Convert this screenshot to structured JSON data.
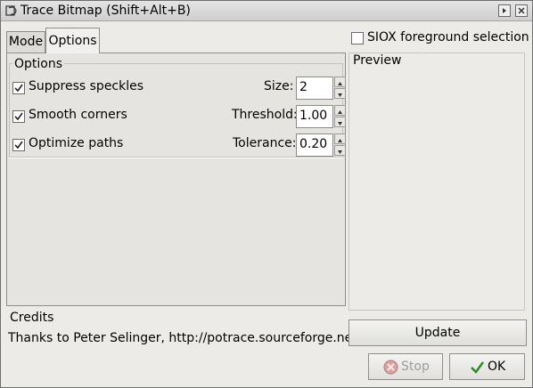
{
  "window": {
    "title": "Trace Bitmap (Shift+Alt+B)"
  },
  "tabs": [
    {
      "label": "Mode",
      "active": false
    },
    {
      "label": "Options",
      "active": true
    }
  ],
  "options": {
    "frame_label": "Options",
    "rows": [
      {
        "label": "Suppress speckles",
        "checked": true,
        "param_label": "Size:",
        "value": "2"
      },
      {
        "label": "Smooth corners",
        "checked": true,
        "param_label": "Threshold:",
        "value": "1.00"
      },
      {
        "label": "Optimize paths",
        "checked": true,
        "param_label": "Tolerance:",
        "value": "0.20"
      }
    ]
  },
  "siox": {
    "label": "SIOX foreground selection",
    "checked": false
  },
  "preview": {
    "label": "Preview"
  },
  "credits": {
    "title": "Credits",
    "text": "Thanks to Peter Selinger, http://potrace.sourceforge.net"
  },
  "buttons": {
    "update": "Update",
    "stop": "Stop",
    "ok": "OK"
  },
  "icons": {
    "app": "trace-bitmap-icon",
    "stop": "stop-icon",
    "ok": "checkmark-icon"
  },
  "colors": {
    "stop_icon": "#c43a3a",
    "ok_icon": "#2a8a2a"
  }
}
